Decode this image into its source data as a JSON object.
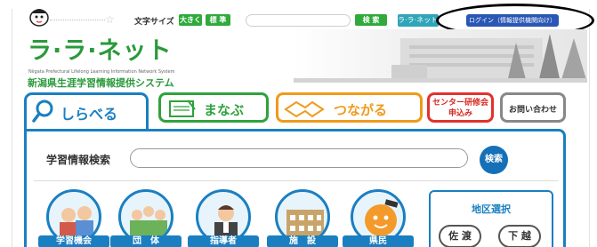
{
  "topbar": {
    "font_size_label": "文字サイズ",
    "large_label": "大きく",
    "standard_label": "標 準",
    "search_button": "検 索",
    "what_is_button": "ラ·ラ·ネットとは？",
    "login_button": "ログイン（情報提供機関向け）"
  },
  "header": {
    "logo_text": "ラ·ラ·ネット",
    "logo_english": "Niigata Prefectural Lifelong Learning Information Network System",
    "logo_japanese": "新潟県生涯学習情報提供システム"
  },
  "tabs": {
    "shiraberu": "しらべる",
    "manabu": "まなぶ",
    "tsunagaru": "つながる",
    "center_training": "センター研修会申込み",
    "contact": "お問い合わせ"
  },
  "main": {
    "search_title": "学習情報検索",
    "search_button": "検索",
    "categories": [
      "学習機会",
      "団　体",
      "指導者",
      "施　設",
      "県民"
    ],
    "region": {
      "title": "地区選択",
      "buttons": [
        "佐 渡",
        "下 越"
      ]
    }
  },
  "colors": {
    "brand_green": "#2a9a3a",
    "shiraberu_blue": "#1a7fc1",
    "manabu_green": "#2fa33b",
    "tsunagaru_orange": "#f09a1a",
    "center_red": "#e2322c",
    "login_blue": "#2a56b4"
  }
}
